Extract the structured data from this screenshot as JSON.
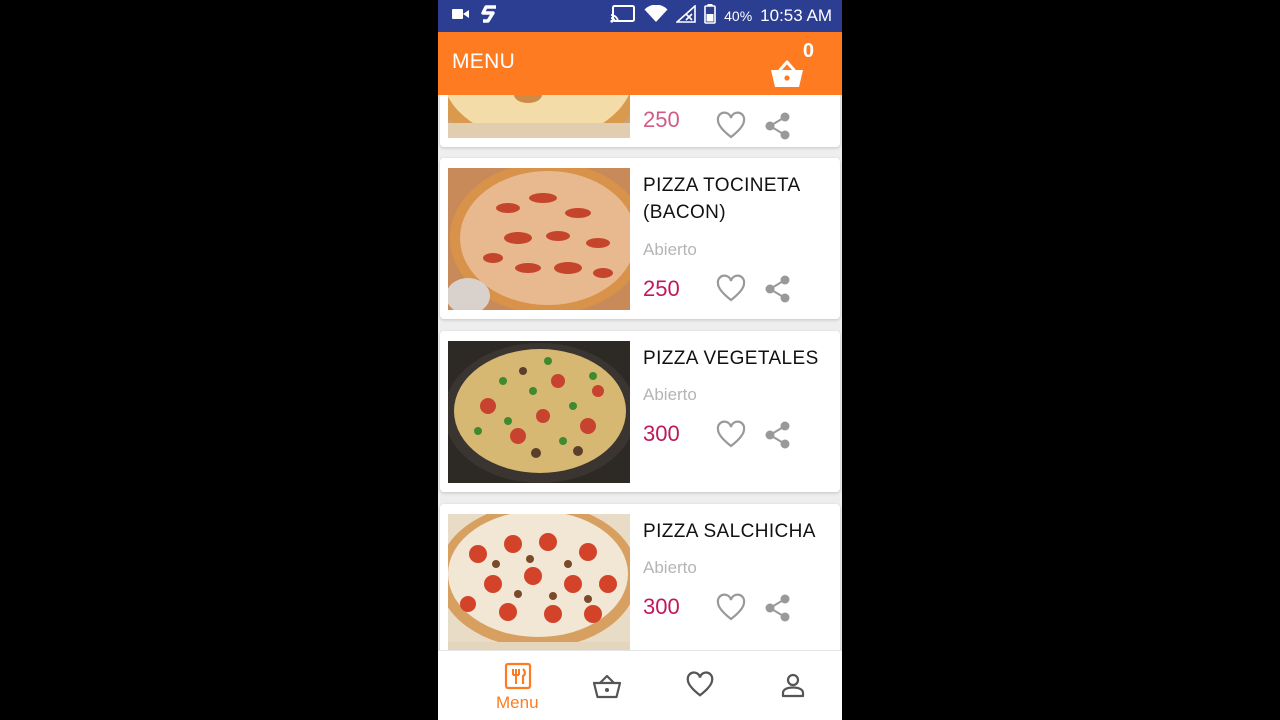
{
  "status_bar": {
    "battery": "40%",
    "time": "10:53 AM"
  },
  "app_bar": {
    "title": "MENU",
    "cart_count": "0"
  },
  "items": [
    {
      "title": "",
      "status": "",
      "price": "250"
    },
    {
      "title": "PIZZA TOCINETA (BACON)",
      "status": "Abierto",
      "price": "250"
    },
    {
      "title": "PIZZA VEGETALES",
      "status": "Abierto",
      "price": "300"
    },
    {
      "title": "PIZZA SALCHICHA",
      "status": "Abierto",
      "price": "300"
    }
  ],
  "bottom_nav": {
    "menu_label": "Menu"
  },
  "colors": {
    "accent": "#ff7b22",
    "status_bar": "#2c3e91",
    "price": "#c2185b"
  }
}
